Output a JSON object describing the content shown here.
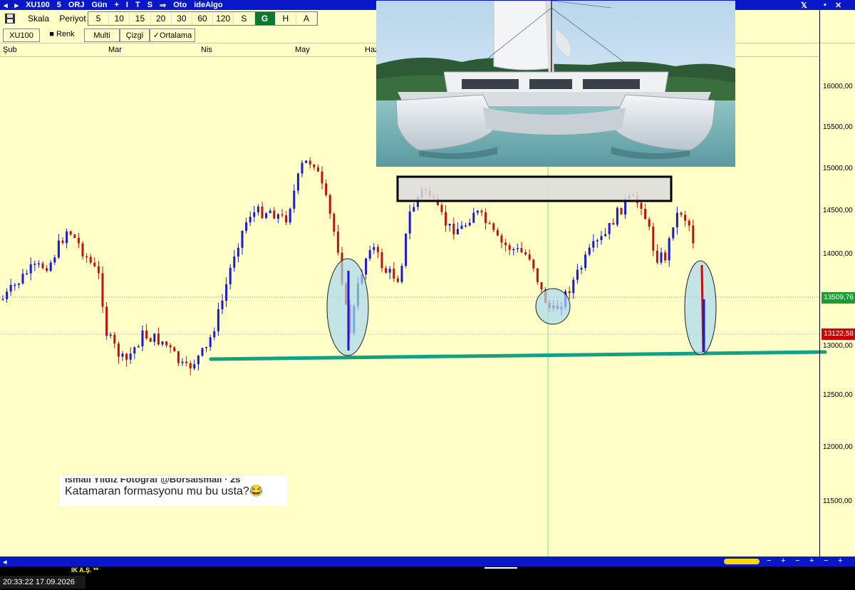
{
  "titlebar": {
    "symbol": "XU100",
    "items": [
      "5",
      "ORJ",
      "Gün",
      "+",
      "I",
      "T",
      "S",
      "⇒",
      "Oto",
      "ideAlgo"
    ],
    "brand": "𝕏"
  },
  "toolbar": {
    "scale_label": "Skala",
    "period_label": "Periyot",
    "periods": [
      "5",
      "10",
      "15",
      "20",
      "30",
      "60",
      "120",
      "S",
      "G",
      "H",
      "A"
    ],
    "active_period": "G"
  },
  "toolbar2": {
    "symbol": "XU100",
    "color_label": "■ Renk",
    "multi_label": "Multi",
    "line_label": "Çizgi",
    "average_label": "✓Ortalama"
  },
  "months": [
    "Şub",
    "Mar",
    "Nis",
    "May",
    "Haz"
  ],
  "price_axis": {
    "ticks": [
      "16000,00",
      "15500,00",
      "15000,00",
      "14500,00",
      "14000,00",
      "13000,00",
      "12500,00",
      "12000,00",
      "11500,00"
    ],
    "current_price": "13509,76",
    "reference_price": "13122,58"
  },
  "overlay": {
    "tweet_faded_header": "İsmail Yıldız Fotoğraf @Borsaismail · 2s",
    "tweet_text": "Katamaran formasyonu mu bu usta?😂",
    "photo_subject": "catamaran-photo"
  },
  "statusbar": {
    "timestamp": "20:33:22 17.09.2026",
    "ticker_fragment": "IK A.Ş. **"
  },
  "colors": {
    "background": "#ffffc8",
    "bar_blue": "#1a1ad0",
    "bar_red": "#c01010",
    "support_line": "#13a184",
    "highlight_fill": "#a8d8f0",
    "title_blue": "#0818c8",
    "active_period": "#0c7a2e"
  }
}
